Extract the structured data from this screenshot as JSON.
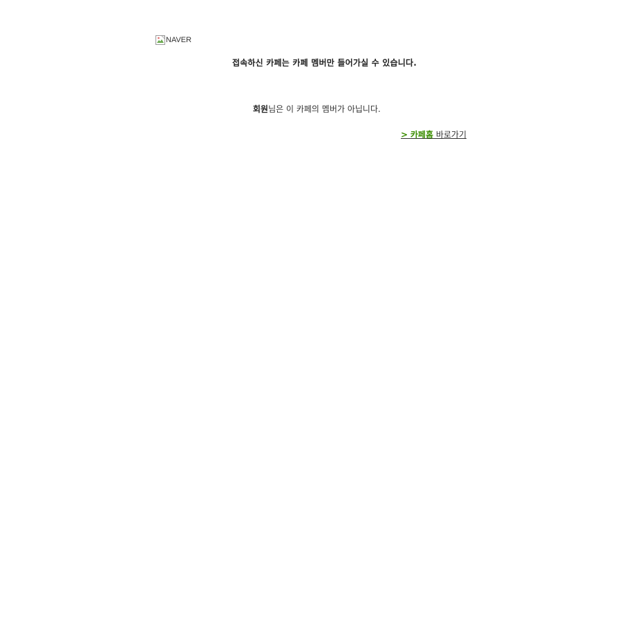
{
  "logo": {
    "alt_text": "NAVER"
  },
  "headline": "접속하신 카페는 카페 멤버만 들어가실 수 있습니다.",
  "message": {
    "member_name": "회원",
    "text": "님은 이 카페의 멤버가 아닙니다."
  },
  "link": {
    "arrow": ">",
    "home_label": "카페홈",
    "goto_label": " 바로가기"
  },
  "colors": {
    "link_green": "#3a8c00",
    "text": "#333333"
  }
}
